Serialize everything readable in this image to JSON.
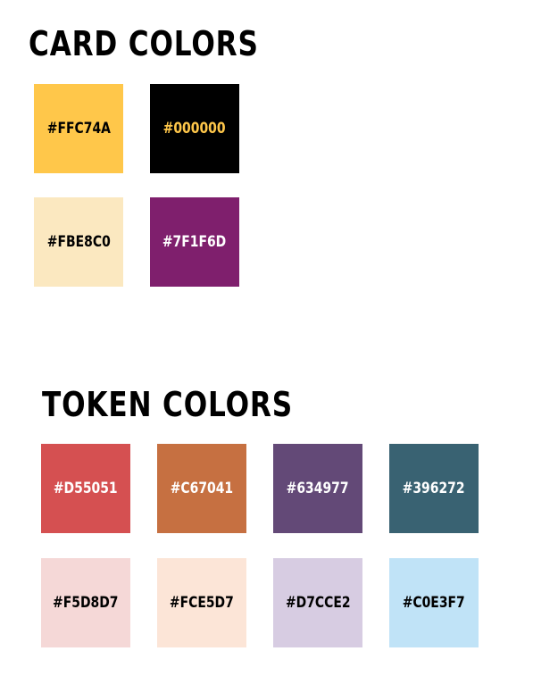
{
  "card_colors": {
    "title": "CARD COLORS",
    "swatches": [
      {
        "label": "#FFC74A",
        "color": "#FFC74A",
        "text_color": "#000000"
      },
      {
        "label": "#000000",
        "color": "#000000",
        "text_color": "#FFC74A"
      },
      {
        "label": "#FBE8C0",
        "color": "#FBE8C0",
        "text_color": "#000000"
      },
      {
        "label": "#7F1F6D",
        "color": "#7F1F6D",
        "text_color": "#FFFFFF"
      }
    ]
  },
  "token_colors": {
    "title": "TOKEN COLORS",
    "swatches": [
      {
        "label": "#D55051",
        "color": "#D55051",
        "text_color": "#FFFFFF"
      },
      {
        "label": "#C67041",
        "color": "#C67041",
        "text_color": "#FFFFFF"
      },
      {
        "label": "#634977",
        "color": "#634977",
        "text_color": "#FFFFFF"
      },
      {
        "label": "#396272",
        "color": "#396272",
        "text_color": "#FFFFFF"
      },
      {
        "label": "#F5D8D7",
        "color": "#F5D8D7",
        "text_color": "#000000"
      },
      {
        "label": "#FCE5D7",
        "color": "#FCE5D7",
        "text_color": "#000000"
      },
      {
        "label": "#D7CCE2",
        "color": "#D7CCE2",
        "text_color": "#000000"
      },
      {
        "label": "#C0E3F7",
        "color": "#C0E3F7",
        "text_color": "#000000"
      }
    ]
  }
}
